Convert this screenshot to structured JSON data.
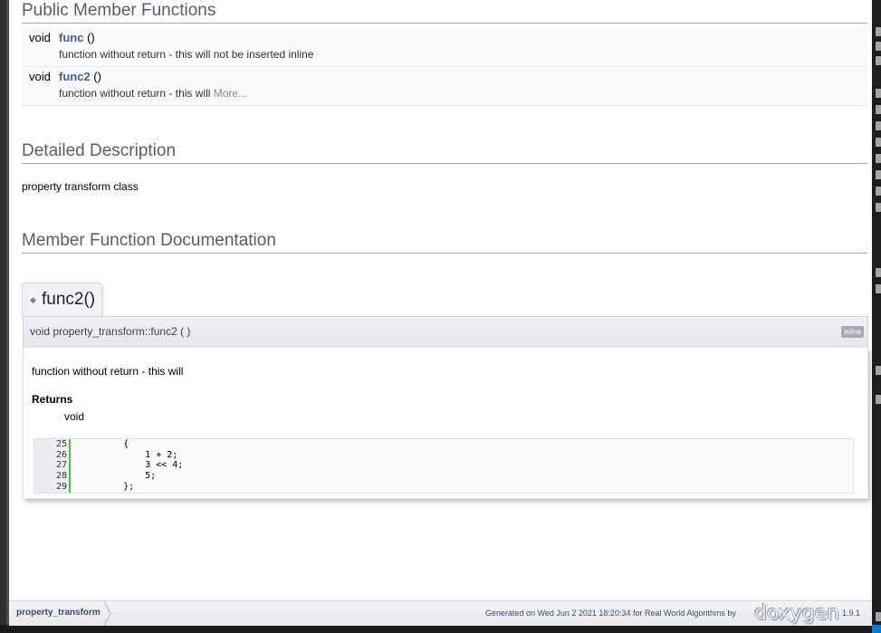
{
  "sections": {
    "public_members": "Public Member Functions",
    "detailed_description": "Detailed Description",
    "member_function_doc": "Member Function Documentation"
  },
  "members": [
    {
      "type": "void",
      "name": "func",
      "args": " ()",
      "desc": "function without return - this will not be inserted inline",
      "more": ""
    },
    {
      "type": "void",
      "name": "func2",
      "args": " ()",
      "desc": "function without return - this will",
      "more": "More..."
    }
  ],
  "description": "property transform class",
  "memitem": {
    "title": "func2()",
    "signature": "void property_transform::func2 (  )",
    "badge": "inline",
    "text": "function without return - this will",
    "returns_heading": "Returns",
    "returns_value": "void",
    "code": [
      {
        "n": "25",
        "c": "    {"
      },
      {
        "n": "26",
        "c": "        1 + 2;"
      },
      {
        "n": "27",
        "c": "        3 << 4;"
      },
      {
        "n": "28",
        "c": "        5;"
      },
      {
        "n": "29",
        "c": "    };"
      }
    ]
  },
  "footer": {
    "breadcrumb": "property_transform",
    "generated": "Generated on Wed Jun 2 2021 18:20:34 for Real World Algorithms by",
    "logo": "doxygen",
    "version": "1.9.1"
  }
}
